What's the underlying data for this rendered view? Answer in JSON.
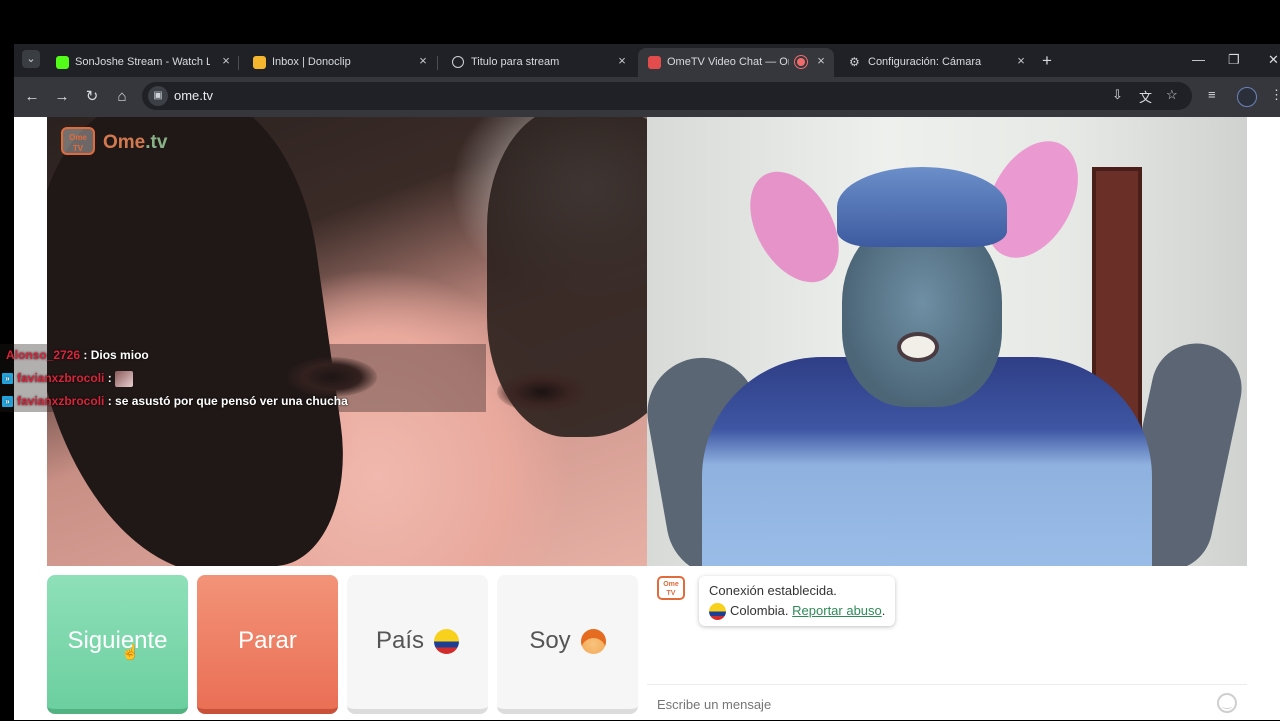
{
  "browser": {
    "tabs": [
      {
        "title": "SonJoshe Stream - Watch Live o",
        "active": false
      },
      {
        "title": "Inbox | Donoclip",
        "active": false
      },
      {
        "title": "Titulo para stream",
        "active": false
      },
      {
        "title": "OmeTV Video Chat — Ome",
        "active": true
      },
      {
        "title": "Configuración: Cámara",
        "active": false
      }
    ],
    "url": "ome.tv"
  },
  "overlay_chat": [
    {
      "user": "Alonso_2726",
      "text": ": Dios mioo"
    },
    {
      "user": "favianxzbrocoli",
      "text": ":"
    },
    {
      "user": "favianxzbrocoli",
      "text": ": se asustó por que pensó ver una chucha"
    }
  ],
  "logo": {
    "text_a": "Ome",
    "text_b": ".tv",
    "badge": "Ome\nTV"
  },
  "controls": {
    "next": "Siguiente",
    "stop": "Parar",
    "country": "País",
    "gender": "Soy"
  },
  "chat": {
    "status": "Conexión establecida.",
    "country": "Colombia.",
    "report": "Reportar abuso",
    "placeholder": "Escribe un mensaje"
  },
  "colors": {
    "next": "#6ccf9f",
    "stop": "#ea6f55",
    "brand": "#e26b3c",
    "link": "#2e8b57"
  }
}
